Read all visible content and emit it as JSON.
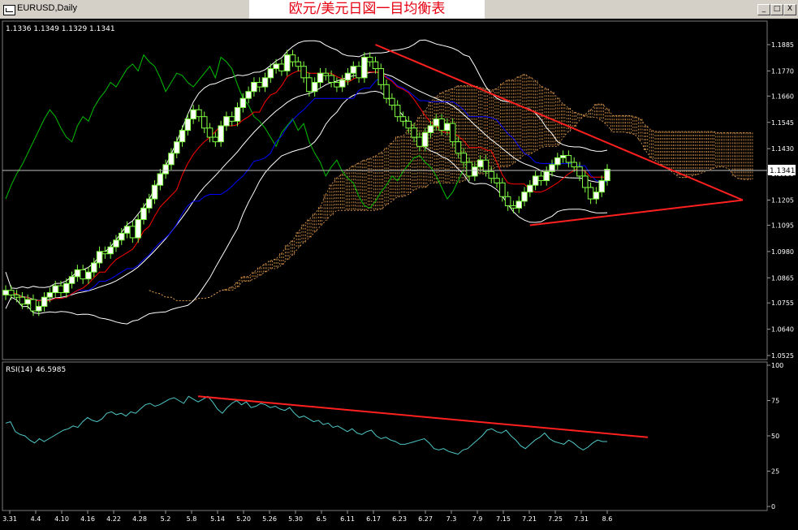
{
  "window": {
    "title": "EURUSD,Daily",
    "banner": "欧元/美元日図一目均衡表",
    "buttons": [
      "_",
      "□",
      "X"
    ]
  },
  "chart_data": [
    {
      "type": "candlestick",
      "title": "EURUSD,Daily",
      "ohlc_readout": "1.1336 1.1349 1.1329 1.1341",
      "current_price_label": "1.1341",
      "y_ticks": [
        "1.1885",
        "1.1770",
        "1.1660",
        "1.1545",
        "1.1430",
        "1.1320",
        "1.1205",
        "1.1095",
        "1.0980",
        "1.0865",
        "1.0755",
        "1.0640",
        "1.0525"
      ],
      "ylim": [
        1.0525,
        1.1885
      ],
      "x_ticks": [
        "3.31",
        "4.4",
        "4.10",
        "4.16",
        "4.22",
        "4.28",
        "5.2",
        "5.8",
        "5.14",
        "5.20",
        "5.26",
        "5.30",
        "6.5",
        "6.11",
        "6.17",
        "6.23",
        "6.27",
        "7.3",
        "7.9",
        "7.15",
        "7.21",
        "7.25",
        "7.31",
        "8.6"
      ],
      "indicators": [
        "Ichimoku Kinko Hyo (tenkan, kijun, chikou, kumo)",
        "Bollinger Bands"
      ],
      "colors": {
        "tenkan": "#ff0000",
        "kijun": "#0000ff",
        "chikou": "#00c000",
        "bollinger": "#ffffff",
        "kumo": "#e8a050",
        "candle": "#80ff40",
        "trendline": "#ff2020"
      },
      "closes": [
        1.081,
        1.079,
        1.078,
        1.075,
        1.077,
        1.072,
        1.074,
        1.078,
        1.08,
        1.083,
        1.08,
        1.084,
        1.087,
        1.09,
        1.086,
        1.089,
        1.093,
        1.098,
        1.097,
        1.1,
        1.103,
        1.106,
        1.109,
        1.104,
        1.112,
        1.117,
        1.121,
        1.127,
        1.132,
        1.136,
        1.141,
        1.146,
        1.151,
        1.156,
        1.16,
        1.157,
        1.152,
        1.148,
        1.146,
        1.153,
        1.157,
        1.155,
        1.161,
        1.165,
        1.168,
        1.172,
        1.17,
        1.174,
        1.178,
        1.18,
        1.177,
        1.184,
        1.181,
        1.179,
        1.174,
        1.168,
        1.172,
        1.176,
        1.175,
        1.172,
        1.17,
        1.173,
        1.176,
        1.179,
        1.174,
        1.183,
        1.181,
        1.178,
        1.171,
        1.165,
        1.162,
        1.157,
        1.155,
        1.152,
        1.148,
        1.144,
        1.15,
        1.153,
        1.156,
        1.151,
        1.154,
        1.146,
        1.141,
        1.137,
        1.131,
        1.135,
        1.138,
        1.133,
        1.13,
        1.128,
        1.122,
        1.118,
        1.117,
        1.12,
        1.124,
        1.127,
        1.131,
        1.129,
        1.133,
        1.136,
        1.139,
        1.14,
        1.137,
        1.135,
        1.131,
        1.126,
        1.121,
        1.124,
        1.129,
        1.134
      ]
    },
    {
      "type": "line",
      "title": "RSI(14)",
      "value_label": "46.5985",
      "y_ticks": [
        "100",
        "75",
        "50",
        "25",
        "0"
      ],
      "ylim": [
        0,
        100
      ],
      "colors": {
        "rsi": "#4fc8c8",
        "trendline": "#ff2020"
      },
      "values": [
        59,
        60,
        53,
        51,
        50,
        47,
        45,
        48,
        46,
        48,
        50,
        52,
        54,
        55,
        57,
        56,
        60,
        63,
        61,
        60,
        62,
        66,
        67,
        65,
        66,
        64,
        67,
        66,
        69,
        72,
        73,
        71,
        72,
        74,
        76,
        77,
        75,
        73,
        78,
        76,
        74,
        76,
        78,
        74,
        69,
        66,
        70,
        73,
        75,
        72,
        74,
        70,
        71,
        73,
        72,
        70,
        71,
        69,
        68,
        70,
        66,
        63,
        64,
        62,
        60,
        61,
        58,
        59,
        56,
        57,
        55,
        53,
        55,
        52,
        51,
        53,
        54,
        50,
        48,
        49,
        47,
        46,
        44,
        44,
        45,
        46,
        47,
        48,
        45,
        41,
        40,
        41,
        39,
        38,
        37,
        40,
        41,
        44,
        47,
        50,
        54,
        55,
        53,
        52,
        54,
        50,
        47,
        43,
        41,
        44,
        47,
        49,
        52,
        48,
        46,
        45,
        44,
        47,
        45,
        42,
        40,
        42,
        45,
        47,
        46,
        46
      ]
    }
  ]
}
